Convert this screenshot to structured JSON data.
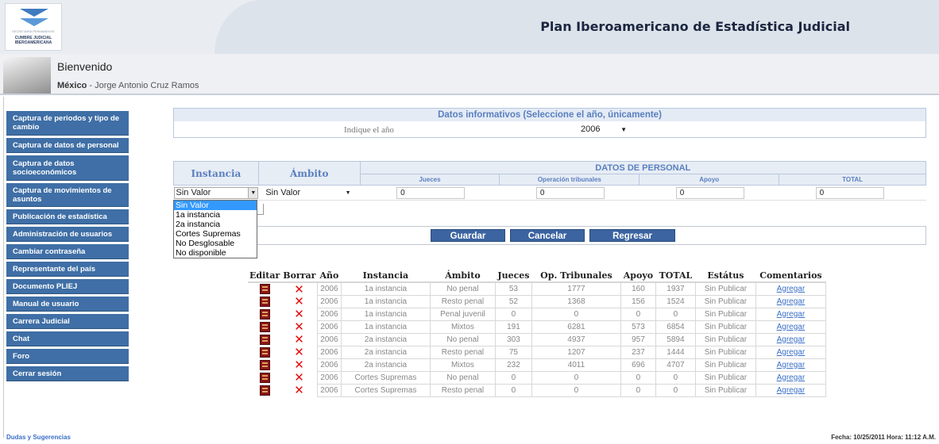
{
  "header": {
    "logo_text": "CUMBRE JUDICIAL IBEROAMERICANA",
    "logo_small": "SECRETARÍA PERMANENTE",
    "title": "Plan Iberoamericano de Estadística Judicial"
  },
  "welcome": {
    "title": "Bienvenido",
    "country": "México",
    "user": " - Jorge Antonio Cruz Ramos"
  },
  "sidebar": {
    "items": [
      {
        "label": "Captura de periodos y tipo de cambio"
      },
      {
        "label": "Captura de datos de personal"
      },
      {
        "label": "Captura de datos socioeconómicos"
      },
      {
        "label": "Captura de movimientos de asuntos"
      },
      {
        "label": "Publicación de estadística"
      },
      {
        "label": "Administración de usuarios"
      },
      {
        "label": "Cambiar contraseña"
      },
      {
        "label": "Representante del país"
      },
      {
        "label": "Documento PLIEJ"
      },
      {
        "label": "Manual de usuario"
      },
      {
        "label": "Carrera Judicial"
      },
      {
        "label": "Chat"
      },
      {
        "label": "Foro"
      },
      {
        "label": "Cerrar sesión"
      }
    ]
  },
  "info": {
    "header": "Datos informativos (Seleccione el año, únicamente)",
    "label": "Indique el año",
    "year": "2006"
  },
  "personal": {
    "col_instancia": "Instancia",
    "col_ambito": "Ámbito",
    "group": "DATOS DE PERSONAL",
    "sub": [
      "Jueces",
      "Operación tribunales",
      "Apoyo",
      "TOTAL"
    ],
    "instancia_value": "Sin Valor",
    "ambito_value": "Sin Valor",
    "jueces": "0",
    "operacion": "0",
    "apoyo": "0",
    "total": "0"
  },
  "dropdown": {
    "options": [
      "Sin Valor",
      "1a instancia",
      "2a instancia",
      "Cortes Supremas",
      "No Desglosable",
      "No disponible"
    ]
  },
  "buttons": {
    "save": "Guardar",
    "cancel": "Cancelar",
    "back": "Regresar"
  },
  "table": {
    "headers": [
      "Editar",
      "Borrar",
      "Año",
      "Instancia",
      "Ámbito",
      "Jueces",
      "Op. Tribunales",
      "Apoyo",
      "TOTAL",
      "Estátus",
      "Comentarios"
    ],
    "rows": [
      {
        "anio": "2006",
        "instancia": "1a instancia",
        "ambito": "No penal",
        "jueces": "53",
        "op": "1777",
        "apoyo": "160",
        "total": "1937",
        "estatus": "Sin Publicar",
        "comentarios": "Agregar"
      },
      {
        "anio": "2006",
        "instancia": "1a instancia",
        "ambito": "Resto penal",
        "jueces": "52",
        "op": "1368",
        "apoyo": "156",
        "total": "1524",
        "estatus": "Sin Publicar",
        "comentarios": "Agregar"
      },
      {
        "anio": "2006",
        "instancia": "1a instancia",
        "ambito": "Penal juvenil",
        "jueces": "0",
        "op": "0",
        "apoyo": "0",
        "total": "0",
        "estatus": "Sin Publicar",
        "comentarios": "Agregar"
      },
      {
        "anio": "2006",
        "instancia": "1a instancia",
        "ambito": "Mixtos",
        "jueces": "191",
        "op": "6281",
        "apoyo": "573",
        "total": "6854",
        "estatus": "Sin Publicar",
        "comentarios": "Agregar"
      },
      {
        "anio": "2006",
        "instancia": "2a instancia",
        "ambito": "No penal",
        "jueces": "303",
        "op": "4937",
        "apoyo": "957",
        "total": "5894",
        "estatus": "Sin Publicar",
        "comentarios": "Agregar"
      },
      {
        "anio": "2006",
        "instancia": "2a instancia",
        "ambito": "Resto penal",
        "jueces": "75",
        "op": "1207",
        "apoyo": "237",
        "total": "1444",
        "estatus": "Sin Publicar",
        "comentarios": "Agregar"
      },
      {
        "anio": "2006",
        "instancia": "2a instancia",
        "ambito": "Mixtos",
        "jueces": "232",
        "op": "4011",
        "apoyo": "696",
        "total": "4707",
        "estatus": "Sin Publicar",
        "comentarios": "Agregar"
      },
      {
        "anio": "2006",
        "instancia": "Cortes Supremas",
        "ambito": "No penal",
        "jueces": "0",
        "op": "0",
        "apoyo": "0",
        "total": "0",
        "estatus": "Sin Publicar",
        "comentarios": "Agregar"
      },
      {
        "anio": "2006",
        "instancia": "Cortes Supremas",
        "ambito": "Resto penal",
        "jueces": "0",
        "op": "0",
        "apoyo": "0",
        "total": "0",
        "estatus": "Sin Publicar",
        "comentarios": "Agregar"
      }
    ]
  },
  "footer": {
    "link": "Dudas y Sugerencias",
    "date": "Fecha: 10/25/2011 Hora: 11:12 A.M."
  }
}
